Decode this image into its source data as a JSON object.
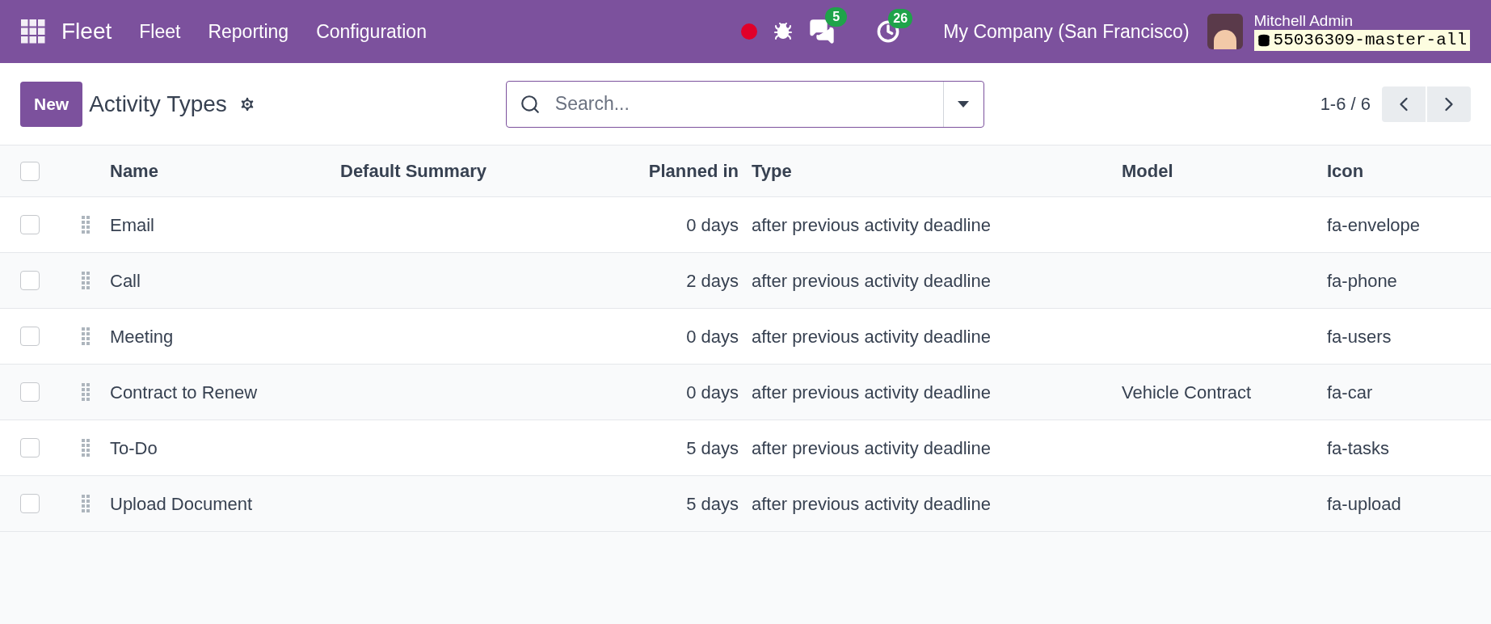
{
  "navbar": {
    "app_name": "Fleet",
    "menu": [
      "Fleet",
      "Reporting",
      "Configuration"
    ],
    "messages_count": "5",
    "activities_count": "26",
    "company": "My Company (San Francisco)",
    "user": "Mitchell Admin",
    "database": "55036309-master-all"
  },
  "control_panel": {
    "new_button": "New",
    "title": "Activity Types",
    "search": {
      "placeholder": "Search..."
    },
    "pager": "1-6 / 6"
  },
  "table": {
    "select_all_checked": false,
    "columns": [
      "Name",
      "Default Summary",
      "Planned in",
      "Type",
      "Model",
      "Icon"
    ],
    "rows": [
      {
        "selected": false,
        "name": "Email",
        "planned_in": "0 days",
        "type": "after previous activity deadline",
        "icon": "fa-envelope"
      },
      {
        "selected": false,
        "name": "Call",
        "planned_in": "2 days",
        "type": "after previous activity deadline",
        "icon": "fa-phone"
      },
      {
        "selected": false,
        "name": "Meeting",
        "planned_in": "0 days",
        "type": "after previous activity deadline",
        "icon": "fa-users"
      },
      {
        "selected": false,
        "name": "Contract to Renew",
        "planned_in": "0 days",
        "type": "after previous activity deadline",
        "model": "Vehicle Contract",
        "icon": "fa-car"
      },
      {
        "selected": false,
        "name": "To-Do",
        "planned_in": "5 days",
        "type": "after previous activity deadline",
        "icon": "fa-tasks"
      },
      {
        "selected": false,
        "name": "Upload Document",
        "planned_in": "5 days",
        "type": "after previous activity deadline",
        "icon": "fa-upload"
      }
    ]
  }
}
